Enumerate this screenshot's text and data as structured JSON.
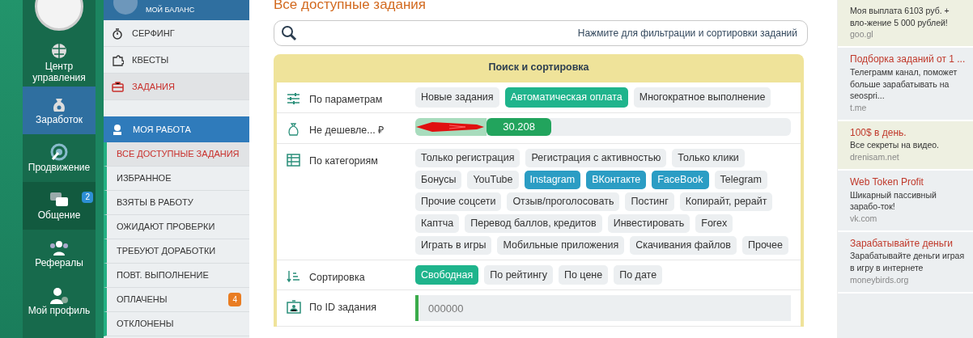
{
  "nav": {
    "items": [
      {
        "label": "Центр управления",
        "selected": false,
        "highlighted": false
      },
      {
        "label": "Заработок",
        "selected": true,
        "highlighted": false
      },
      {
        "label": "Продвижение",
        "selected": false,
        "highlighted": false
      },
      {
        "label": "Общение",
        "selected": false,
        "highlighted": true,
        "badge": "2"
      },
      {
        "label": "Рефералы",
        "selected": false,
        "highlighted": false
      },
      {
        "label": "Мой профиль",
        "selected": false,
        "highlighted": false
      }
    ]
  },
  "menu": {
    "balance_label": "МОЙ БАЛАНС",
    "items": [
      {
        "label": "СЕРФИНГ",
        "selected": false
      },
      {
        "label": "КВЕСТЫ",
        "selected": false
      },
      {
        "label": "ЗАДАНИЯ",
        "selected": true
      }
    ],
    "section_title": "МОЯ РАБОТА",
    "work_items": [
      {
        "label": "ВСЕ ДОСТУПНЫЕ ЗАДАНИЯ",
        "selected": true
      },
      {
        "label": "ИЗБРАННОЕ",
        "selected": false
      },
      {
        "label": "ВЗЯТЫ В РАБОТУ",
        "selected": false
      },
      {
        "label": "ОЖИДАЮТ ПРОВЕРКИ",
        "selected": false
      },
      {
        "label": "ТРЕБУЮТ ДОРАБОТКИ",
        "selected": false
      },
      {
        "label": "ПОВТ. ВЫПОЛНЕНИЕ",
        "selected": false
      },
      {
        "label": "ОПЛАЧЕНЫ",
        "selected": false,
        "badge": "4"
      },
      {
        "label": "ОТКЛОНЕНЫ",
        "selected": false
      }
    ]
  },
  "main": {
    "title": "Все доступные задания",
    "search_hint": "Нажмите для фильтрации и сортировки заданий",
    "panel": {
      "title": "Поиск и сортировка",
      "rows": [
        {
          "kind": "options",
          "label": "По параметрам",
          "chips": [
            {
              "label": "Новые задания",
              "selected": false
            },
            {
              "label": "Автоматическая оплата",
              "selected": true
            },
            {
              "label": "Многократное выполнение",
              "selected": false
            }
          ]
        },
        {
          "kind": "slider",
          "label": "Не дешевле... ₽",
          "level": 0.19,
          "reading": "30.208"
        },
        {
          "kind": "categories",
          "label": "По категориям",
          "chips": [
            {
              "label": "Только регистрация",
              "selected": false
            },
            {
              "label": "Регистрация с активностью",
              "selected": false
            },
            {
              "label": "Только клики",
              "selected": false
            },
            {
              "label": "Бонусы",
              "selected": false
            },
            {
              "label": "YouTube",
              "selected": false
            },
            {
              "label": "Instagram",
              "selected": true
            },
            {
              "label": "ВКонтакте",
              "selected": true
            },
            {
              "label": "FaceBook",
              "selected": true
            },
            {
              "label": "Telegram",
              "selected": false
            },
            {
              "label": "Прочие соцсети",
              "selected": false
            },
            {
              "label": "Отзыв/проголосовать",
              "selected": false
            },
            {
              "label": "Постинг",
              "selected": false
            },
            {
              "label": "Копирайт, рерайт",
              "selected": false
            },
            {
              "label": "Каптча",
              "selected": false
            },
            {
              "label": "Перевод баллов, кредитов",
              "selected": false
            },
            {
              "label": "Инвестировать",
              "selected": false
            },
            {
              "label": "Forex",
              "selected": false
            },
            {
              "label": "Играть в игры",
              "selected": false
            },
            {
              "label": "Мобильные приложения",
              "selected": false
            },
            {
              "label": "Скачивания файлов",
              "selected": false
            },
            {
              "label": "Прочее",
              "selected": false
            }
          ]
        },
        {
          "kind": "options",
          "label": "Сортировка",
          "chips": [
            {
              "label": "Свободная",
              "selected": true
            },
            {
              "label": "По рейтингу",
              "selected": false
            },
            {
              "label": "По цене",
              "selected": false
            },
            {
              "label": "По дате",
              "selected": false
            }
          ]
        },
        {
          "kind": "field",
          "label": "По ID задания",
          "placeholder": "000000"
        }
      ]
    }
  },
  "ads": [
    {
      "text": "Моя выплата 6103 руб. + вло-жение 5 000 рублей!",
      "domain": "goo.gl",
      "highlighted": true
    },
    {
      "title": "Подборка заданий от 1 ...",
      "text": "Телеграмм канал, поможет больше зарабатывать на seospri...",
      "domain": "t.me",
      "highlighted": false
    },
    {
      "title": "100$ в день.",
      "text": "Все секреты на видео.",
      "domain": "drenisam.net",
      "highlighted": true
    },
    {
      "title": "Web Token Profit",
      "text": "Шикарный пассивный зарабо-ток!",
      "domain": "vk.com",
      "highlighted": false
    },
    {
      "title": "Зарабатывайте деньги",
      "text": "Зарабатывайте деньги играя в игру в интернете",
      "domain": "moneybirds.org",
      "highlighted": false
    }
  ]
}
